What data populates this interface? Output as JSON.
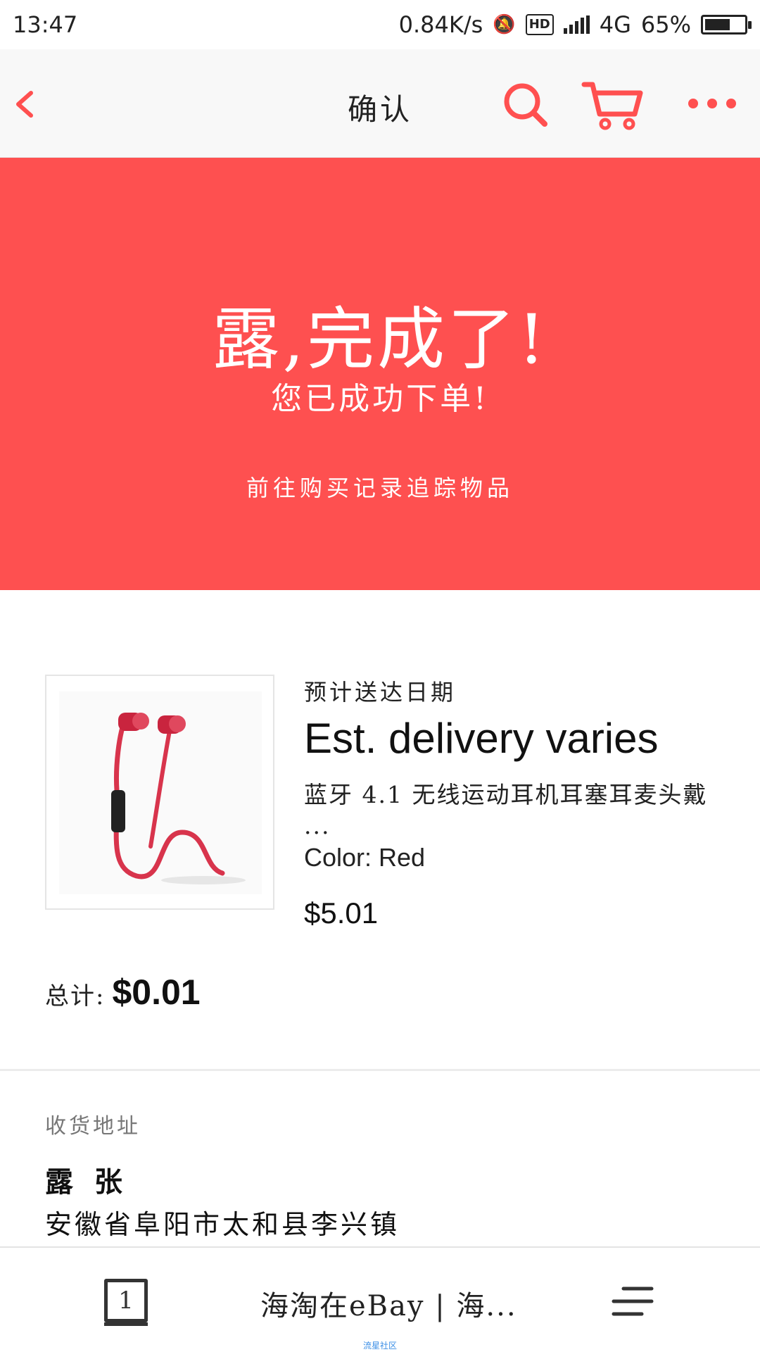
{
  "status_bar": {
    "time": "13:47",
    "net_speed": "0.84K/s",
    "hd": "HD",
    "network": "4G",
    "battery": "65%",
    "battery_level": 0.65
  },
  "header": {
    "title": "确认",
    "back_icon": "chevron-left-icon",
    "search_icon": "search-icon",
    "cart_icon": "cart-icon",
    "more_icon": "more-dots-icon"
  },
  "banner": {
    "headline": "露,完成了!",
    "subtitle": "您已成功下单!",
    "link": "前往购买记录追踪物品",
    "color": "#fe5050"
  },
  "item": {
    "delivery_label": "预计送达日期",
    "delivery_value": "Est. delivery varies",
    "title": "蓝牙 4.1 无线运动耳机耳塞耳麦头戴",
    "title_ellipsis": "...",
    "color": "Color: Red",
    "price": "$5.01",
    "image_icon": "earphones-image"
  },
  "total": {
    "label": "总计:",
    "value": "$0.01"
  },
  "shipping": {
    "label": "收货地址",
    "name": "露 张",
    "address": "安徽省阜阳市太和县李兴镇"
  },
  "browser_bar": {
    "tab_count": "1",
    "page_title": "海淘在eBay | 海...",
    "menu_icon": "menu-icon"
  },
  "watermark": "流星社区"
}
